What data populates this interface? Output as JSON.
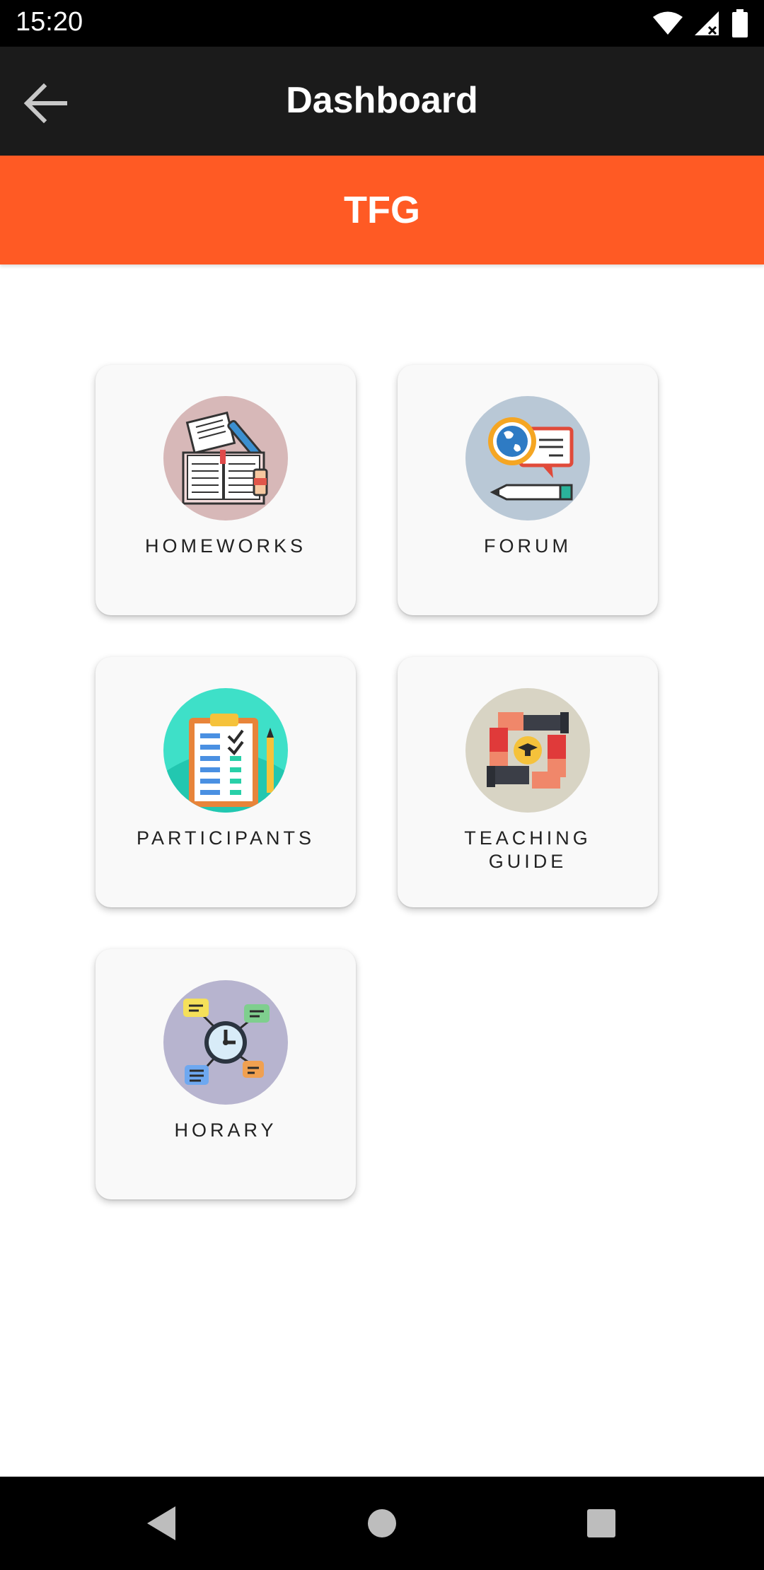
{
  "status_bar": {
    "time": "15:20"
  },
  "app_bar": {
    "title": "Dashboard"
  },
  "banner": {
    "course_title": "TFG"
  },
  "menu": [
    {
      "label": "HOMEWORKS",
      "icon": "homework-book-icon"
    },
    {
      "label": "FORUM",
      "icon": "forum-globe-chat-icon"
    },
    {
      "label": "PARTICIPANTS",
      "icon": "participants-clipboard-icon"
    },
    {
      "label": "TEACHING GUIDE",
      "icon": "teaching-guide-hands-icon"
    },
    {
      "label": "HORARY",
      "icon": "horary-clock-icon"
    }
  ],
  "colors": {
    "app_bar": "#1b1b1b",
    "accent": "#ff5a24",
    "card": "#f9f9f9"
  }
}
